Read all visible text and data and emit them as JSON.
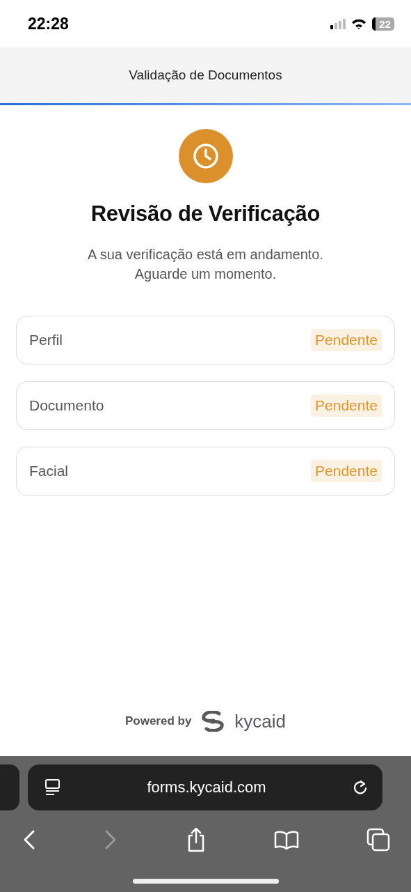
{
  "status_bar": {
    "time": "22:28",
    "battery": "22"
  },
  "header": {
    "title": "Validação de Documentos"
  },
  "main": {
    "title": "Revisão de Verificação",
    "subtitle": "A sua verificação está em andamento. Aguarde um momento.",
    "items": [
      {
        "label": "Perfil",
        "status": "Pendente",
        "color": "#e0962b"
      },
      {
        "label": "Documento",
        "status": "Pendente",
        "color": "#e0962b"
      },
      {
        "label": "Facial",
        "status": "Pendente",
        "color": "#e0962b"
      }
    ]
  },
  "footer": {
    "powered_by": "Powered by",
    "brand": "kycaid"
  },
  "browser": {
    "url": "forms.kycaid.com",
    "back_disabled": false,
    "forward_disabled": true
  }
}
